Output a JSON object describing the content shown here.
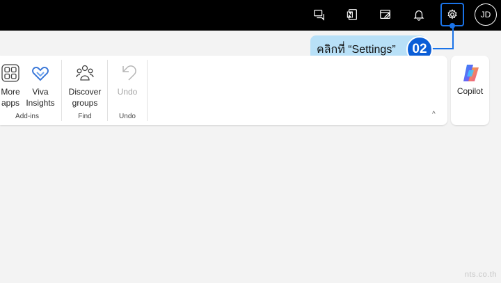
{
  "topbar": {
    "icons": [
      "chat-icon",
      "onenote-icon",
      "whiteboard-icon",
      "notification-bell-icon",
      "settings-gear-icon"
    ],
    "avatar_initials": "JD"
  },
  "callout": {
    "text": "คลิกที่ “Settings”",
    "step": "02"
  },
  "ribbon": {
    "buttons": [
      {
        "label1": "More",
        "label2": "apps"
      },
      {
        "label1": "Viva",
        "label2": "Insights"
      },
      {
        "label1": "Discover",
        "label2": "groups"
      },
      {
        "label1": "Undo",
        "label2": ""
      }
    ],
    "groups": [
      "Add-ins",
      "Find",
      "Undo"
    ]
  },
  "copilot": {
    "label": "Copilot"
  },
  "watermark": "nts.co.th",
  "colors": {
    "accent": "#1a73e8",
    "callout_bg": "#b8e0f7",
    "badge": "#0b5ed7"
  }
}
